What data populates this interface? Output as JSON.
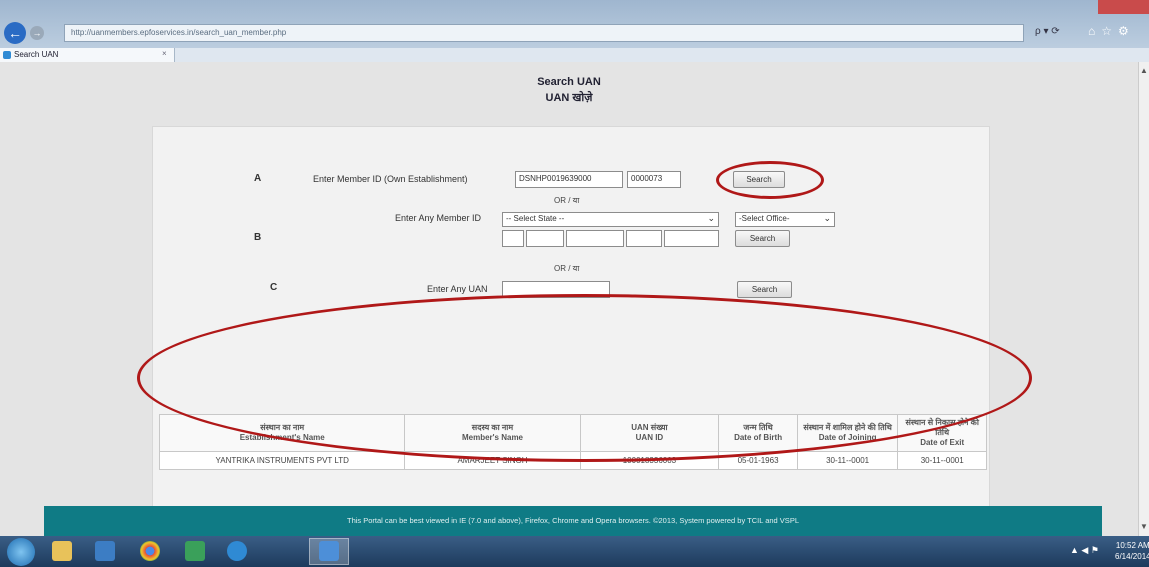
{
  "browser": {
    "url": "http://uanmembers.epfoservices.in/search_uan_member.php",
    "tab_title": "Search UAN",
    "addr_ctrl": "ρ ▾ ⟳"
  },
  "page": {
    "title_en": "Search UAN",
    "title_hi": "UAN खोज़े"
  },
  "section_a": {
    "letter": "A",
    "label": "Enter Member ID (Own Establishment)",
    "est_code": "DSNHP0019639000",
    "member_no": "0000073",
    "search_label": "Search"
  },
  "or_label": "OR / या",
  "section_b": {
    "letter": "B",
    "label": "Enter Any Member ID",
    "state_select": "-- Select State --",
    "office_select": "-Select Office-",
    "search_label": "Search"
  },
  "section_c": {
    "letter": "C",
    "label": "Enter Any UAN",
    "uan_value": "",
    "search_label": "Search"
  },
  "results": {
    "headers": [
      {
        "hi": "संस्थान का नाम",
        "en": "Establishment's Name"
      },
      {
        "hi": "सदस्य का नाम",
        "en": "Member's Name"
      },
      {
        "hi": "UAN संख्या",
        "en": "UAN ID"
      },
      {
        "hi": "जन्म तिथि",
        "en": "Date of Birth"
      },
      {
        "hi": "संस्थान में शामिल होने की तिथि",
        "en": "Date of Joining"
      },
      {
        "hi": "संस्थान से निकास होने की तिथि",
        "en": "Date of Exit"
      }
    ],
    "rows": [
      {
        "establishment": "YANTRIKA INSTRUMENTS PVT LTD",
        "member": "AMARJEET SINGH",
        "uan": "100018336003",
        "dob": "05-01-1963",
        "doj": "30-11--0001",
        "doe": "30-11--0001"
      }
    ]
  },
  "footer": {
    "text": "This Portal can be best viewed in IE (7.0 and above), Firefox, Chrome and Opera browsers.      ©2013, System powered by TCIL and VSPL"
  },
  "taskbar": {
    "time": "10:52 AM",
    "date": "6/14/2014"
  },
  "colors": {
    "annotation_red": "#b01818",
    "footer_teal": "#0f7b85"
  }
}
